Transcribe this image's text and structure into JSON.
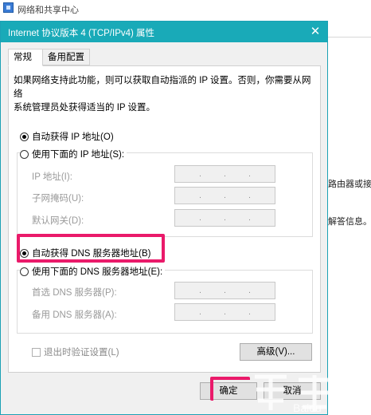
{
  "background_window": {
    "title": "网络和共享中心",
    "right_text_1": "路由器或接",
    "right_text_2": "解答信息。"
  },
  "dialog": {
    "title": "Internet 协议版本 4 (TCP/IPv4) 属性",
    "close_symbol": "✕",
    "tabs": [
      "常规",
      "备用配置"
    ],
    "description_line1": "如果网络支持此功能，则可以获取自动指派的 IP 设置。否则，你需要从网络",
    "description_line2": "系统管理员处获得适当的 IP 设置。",
    "ip_auto_label": "自动获得 IP 地址(O)",
    "ip_manual_label": "使用下面的 IP 地址(S):",
    "ip_fields": [
      {
        "label": "IP 地址(I):",
        "value": ". . ."
      },
      {
        "label": "子网掩码(U):",
        "value": ". . ."
      },
      {
        "label": "默认网关(D):",
        "value": ". . ."
      }
    ],
    "dns_auto_label": "自动获得 DNS 服务器地址(B)",
    "dns_manual_label": "使用下面的 DNS 服务器地址(E):",
    "dns_fields": [
      {
        "label": "首选 DNS 服务器(P):",
        "value": ". . ."
      },
      {
        "label": "备用 DNS 服务器(A):",
        "value": ". . ."
      }
    ],
    "validate_label": "退出时验证设置(L)",
    "advanced_label": "高级(V)...",
    "ok_label": "确定",
    "cancel_label": "取消",
    "selected_ip_mode": "auto",
    "selected_dns_mode": "auto"
  },
  "watermark_text": "Baidu",
  "colors": {
    "titlebar": "#19aab8",
    "highlight": "#ea1a6a"
  }
}
